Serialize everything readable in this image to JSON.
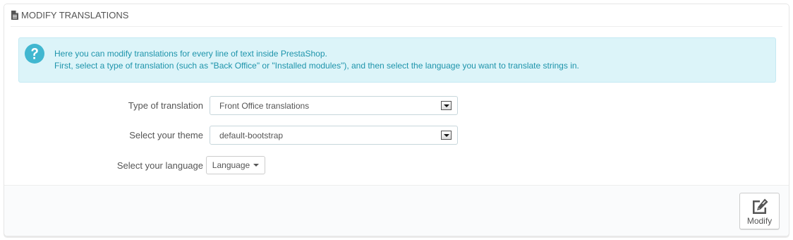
{
  "panel": {
    "title": "Modify translations",
    "title_icon": "document-icon"
  },
  "info": {
    "icon": "question-circle-icon",
    "line1": "Here you can modify translations for every line of text inside PrestaShop.",
    "line2": "First, select a type of translation (such as \"Back Office\" or \"Installed modules\"), and then select the language you want to translate strings in.",
    "color": "#1e94ab",
    "background": "#dcf4f9"
  },
  "form": {
    "type": {
      "label": "Type of translation",
      "value": "Front Office translations"
    },
    "theme": {
      "label": "Select your theme",
      "value": "default-bootstrap"
    },
    "language": {
      "label": "Select your language",
      "button": "Language"
    }
  },
  "footer": {
    "modify_label": "Modify",
    "modify_icon": "edit-icon"
  }
}
